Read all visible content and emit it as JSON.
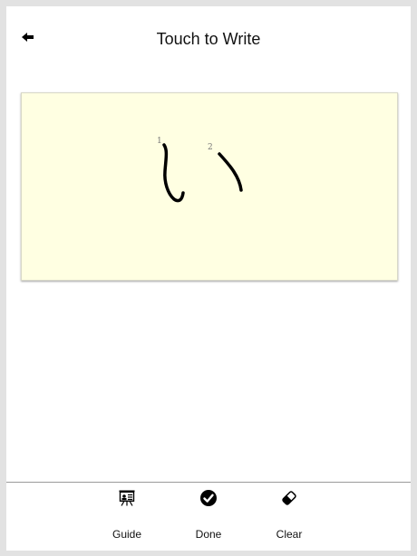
{
  "header": {
    "title": "Touch to Write",
    "back_icon": "back-arrow-icon"
  },
  "canvas": {
    "background_color": "#ffffe2",
    "stroke_numbers": [
      "1",
      "2"
    ]
  },
  "toolbar": {
    "guide_label": "Guide",
    "guide_icon": "presentation-board-icon",
    "done_label": "Done",
    "done_icon": "checkmark-circle-icon",
    "clear_label": "Clear",
    "clear_icon": "eraser-icon"
  }
}
